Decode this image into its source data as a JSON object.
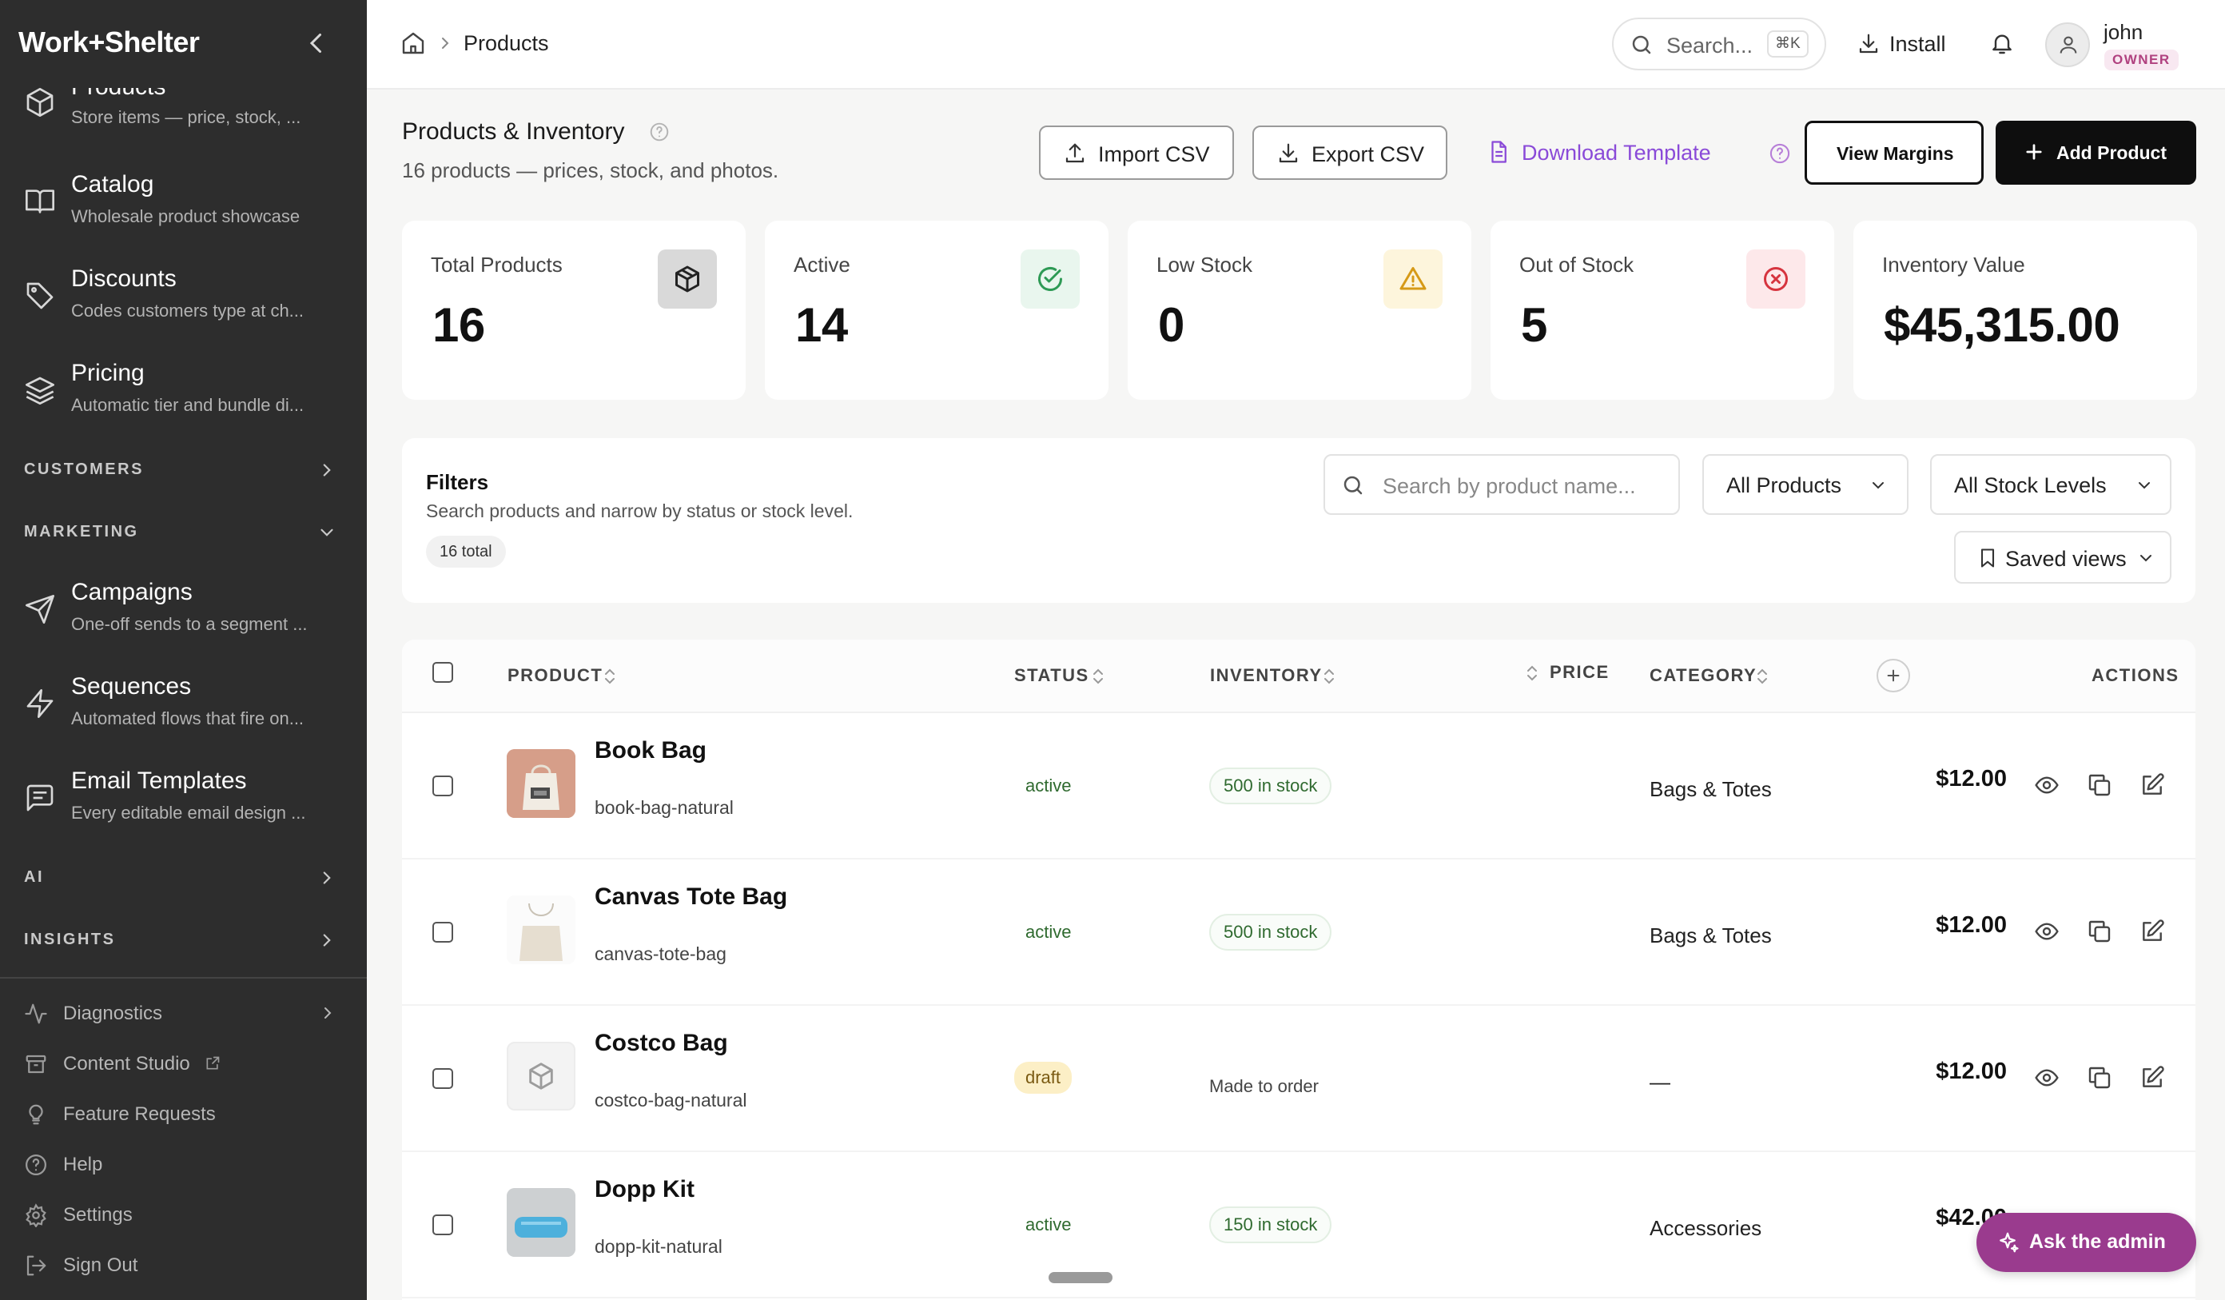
{
  "sidebar": {
    "logo": "Work+Shelter",
    "nav": [
      {
        "label": "Products",
        "sub": "Store items — price, stock, ...",
        "icon": "cube-icon"
      },
      {
        "label": "Catalog",
        "sub": "Wholesale product showcase",
        "icon": "book-open-icon"
      },
      {
        "label": "Discounts",
        "sub": "Codes customers type at ch...",
        "icon": "tag-icon"
      },
      {
        "label": "Pricing",
        "sub": "Automatic tier and bundle di...",
        "icon": "layers-icon"
      }
    ],
    "sections": {
      "customers": "CUSTOMERS",
      "marketing": "MARKETING",
      "ai": "AI",
      "insights": "INSIGHTS"
    },
    "marketing_items": [
      {
        "label": "Campaigns",
        "sub": "One-off sends to a segment ...",
        "icon": "send-icon"
      },
      {
        "label": "Sequences",
        "sub": "Automated flows that fire on...",
        "icon": "zap-icon"
      },
      {
        "label": "Email Templates",
        "sub": "Every editable email design ...",
        "icon": "message-square-icon"
      }
    ],
    "footer": [
      {
        "label": "Diagnostics",
        "icon": "activity-icon"
      },
      {
        "label": "Content Studio",
        "icon": "archive-icon"
      },
      {
        "label": "Feature Requests",
        "icon": "lightbulb-icon"
      },
      {
        "label": "Help",
        "icon": "help-circle-icon"
      },
      {
        "label": "Settings",
        "icon": "gear-icon"
      },
      {
        "label": "Sign Out",
        "icon": "logout-icon"
      }
    ]
  },
  "topbar": {
    "breadcrumb": "Products",
    "search_placeholder": "Search...",
    "search_shortcut": "⌘K",
    "install_label": "Install",
    "user_name": "john",
    "user_role": "OWNER"
  },
  "page": {
    "title": "Products & Inventory",
    "subtitle": "16 products — prices, stock, and photos.",
    "import_csv": "Import CSV",
    "export_csv": "Export CSV",
    "download_template": "Download Template",
    "view_margins": "View Margins",
    "add_product": "Add Product"
  },
  "stats": [
    {
      "label": "Total Products",
      "value": "16",
      "icon": "cube-icon"
    },
    {
      "label": "Active",
      "value": "14",
      "icon": "check-circle-icon"
    },
    {
      "label": "Low Stock",
      "value": "0",
      "icon": "warning-triangle-icon"
    },
    {
      "label": "Out of Stock",
      "value": "5",
      "icon": "x-circle-icon"
    },
    {
      "label": "Inventory Value",
      "value": "$45,315.00"
    }
  ],
  "filters": {
    "title": "Filters",
    "subtitle": "Search products and narrow by status or stock level.",
    "count": "16 total",
    "search_placeholder": "Search by product name...",
    "product_filter": "All Products",
    "stock_filter": "All Stock Levels",
    "saved_views": "Saved views"
  },
  "table": {
    "columns": {
      "product": "PRODUCT",
      "status": "STATUS",
      "inventory": "INVENTORY",
      "price": "PRICE",
      "category": "CATEGORY",
      "actions": "ACTIONS"
    },
    "rows": [
      {
        "name": "Book Bag",
        "slug": "book-bag-natural",
        "status": "active",
        "inventory": "500 in stock",
        "price": "$12.00",
        "category": "Bags & Totes",
        "thumb": "tote-photo"
      },
      {
        "name": "Canvas Tote Bag",
        "slug": "canvas-tote-bag",
        "status": "active",
        "inventory": "500 in stock",
        "price": "$12.00",
        "category": "Bags & Totes",
        "thumb": "canvas-photo"
      },
      {
        "name": "Costco Bag",
        "slug": "costco-bag-natural",
        "status": "draft",
        "inventory": "Made to order",
        "price": "$12.00",
        "category": "—",
        "thumb": "placeholder-cube"
      },
      {
        "name": "Dopp Kit",
        "slug": "dopp-kit-natural",
        "status": "active",
        "inventory": "150 in stock",
        "price": "$42.00",
        "category": "Accessories",
        "thumb": "dopp-photo"
      }
    ]
  },
  "assistant": {
    "label": "Ask the admin"
  },
  "colors": {
    "sidebar_bg": "#2d2d2d",
    "accent_purple": "#9a3b8e",
    "link_purple": "#8a4ad8",
    "active_green": "#2f6a2f",
    "draft_yellow": "#fcefc6"
  }
}
